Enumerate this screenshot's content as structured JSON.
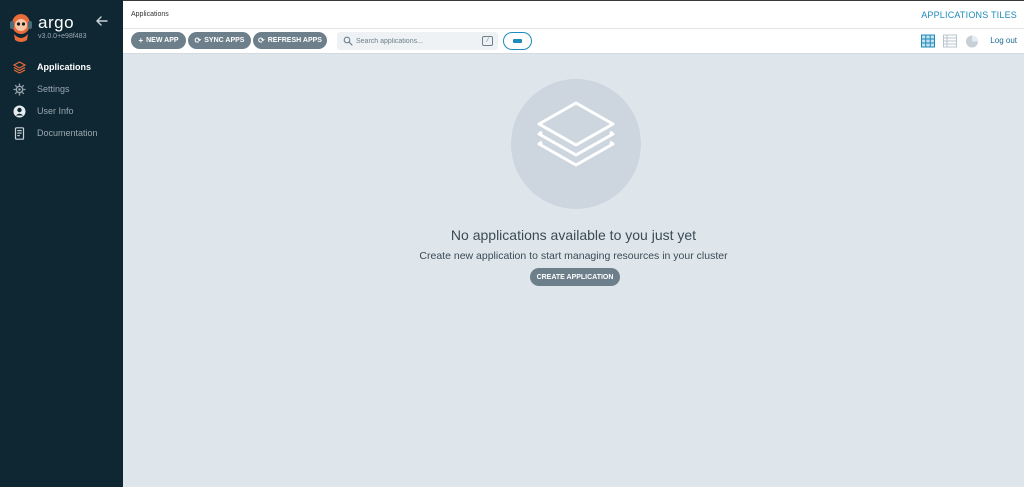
{
  "sidebar": {
    "brand": "argo",
    "version": "v3.0.0+e98f483",
    "items": [
      {
        "label": "Applications",
        "icon": "layers-icon",
        "active": true
      },
      {
        "label": "Settings",
        "icon": "gear-icon",
        "active": false
      },
      {
        "label": "User Info",
        "icon": "user-icon",
        "active": false
      },
      {
        "label": "Documentation",
        "icon": "book-icon",
        "active": false
      }
    ]
  },
  "header": {
    "breadcrumb": "Applications",
    "view_title": "APPLICATIONS TILES"
  },
  "toolbar": {
    "new_app": "NEW APP",
    "sync_apps": "SYNC APPS",
    "refresh_apps": "REFRESH APPS",
    "search_placeholder": "Search applications...",
    "search_shortcut": "/",
    "logout": "Log out",
    "active_view": "tiles"
  },
  "empty_state": {
    "title": "No applications available to you just yet",
    "subtitle": "Create new application to start managing resources in your cluster",
    "button": "CREATE APPLICATION"
  },
  "colors": {
    "sidebar_bg": "#0f2733",
    "content_bg": "#dee6eb",
    "accent": "#1e8bbd",
    "button_bg": "#6d7f8b",
    "brand_orange": "#e96d3b"
  }
}
